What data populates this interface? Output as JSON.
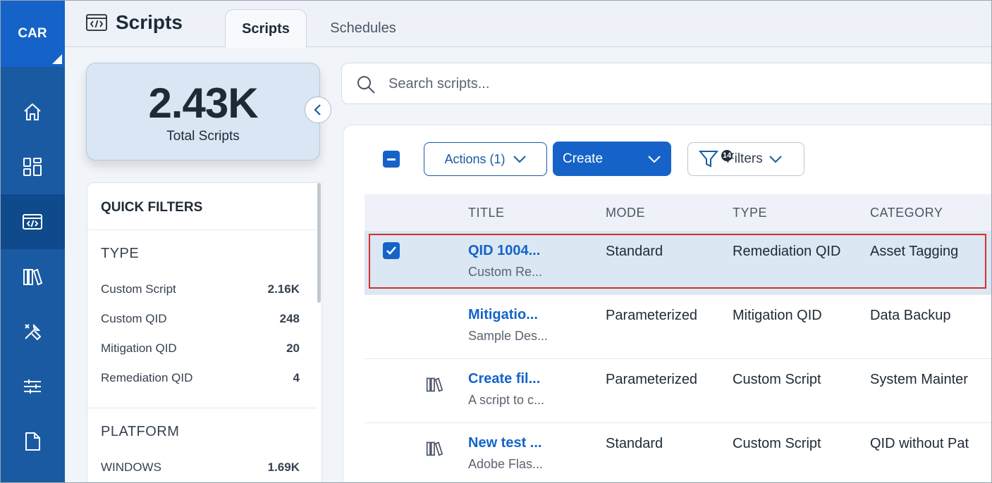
{
  "rail": {
    "app_label": "CAR",
    "items": [
      {
        "icon": "home-icon"
      },
      {
        "icon": "dashboard-icon"
      },
      {
        "icon": "code-icon",
        "active": true
      },
      {
        "icon": "library-icon"
      },
      {
        "icon": "tools-icon"
      },
      {
        "icon": "sliders-icon"
      },
      {
        "icon": "file-icon"
      }
    ]
  },
  "header": {
    "title": "Scripts",
    "tabs": [
      {
        "label": "Scripts",
        "active": true
      },
      {
        "label": "Schedules",
        "active": false
      }
    ]
  },
  "summary": {
    "value": "2.43K",
    "label": "Total Scripts"
  },
  "quick_filters": {
    "title": "QUICK FILTERS",
    "sections": [
      {
        "title": "TYPE",
        "items": [
          {
            "label": "Custom Script",
            "count": "2.16K"
          },
          {
            "label": "Custom QID",
            "count": "248"
          },
          {
            "label": "Mitigation QID",
            "count": "20"
          },
          {
            "label": "Remediation QID",
            "count": "4"
          }
        ]
      },
      {
        "title": "PLATFORM",
        "items": [
          {
            "label": "WINDOWS",
            "count": "1.69K"
          }
        ]
      }
    ]
  },
  "search": {
    "placeholder": "Search scripts..."
  },
  "toolbar": {
    "actions_label": "Actions (1)",
    "create_label": "Create",
    "filters_label": "Filters",
    "filters_badge": "14"
  },
  "table": {
    "columns": [
      "TITLE",
      "MODE",
      "TYPE",
      "CATEGORY"
    ],
    "rows": [
      {
        "title": "QID 1004...",
        "subtitle": "Custom Re...",
        "mode": "Standard",
        "type": "Remediation QID",
        "category": "Asset Tagging",
        "selected": true,
        "has_icon": false
      },
      {
        "title": "Mitigatio...",
        "subtitle": "Sample Des...",
        "mode": "Parameterized",
        "type": "Mitigation QID",
        "category": "Data Backup",
        "selected": false,
        "has_icon": false
      },
      {
        "title": "Create fil...",
        "subtitle": "A script to c...",
        "mode": "Parameterized",
        "type": "Custom Script",
        "category": "System Mainter",
        "selected": false,
        "has_icon": true
      },
      {
        "title": "New test ...",
        "subtitle": "Adobe Flas...",
        "mode": "Standard",
        "type": "Custom Script",
        "category": "QID without Pat",
        "selected": false,
        "has_icon": true
      }
    ]
  },
  "colors": {
    "rail": "#1a5aa3",
    "accent": "#1563c8",
    "selection_outline": "#d32f2f"
  }
}
